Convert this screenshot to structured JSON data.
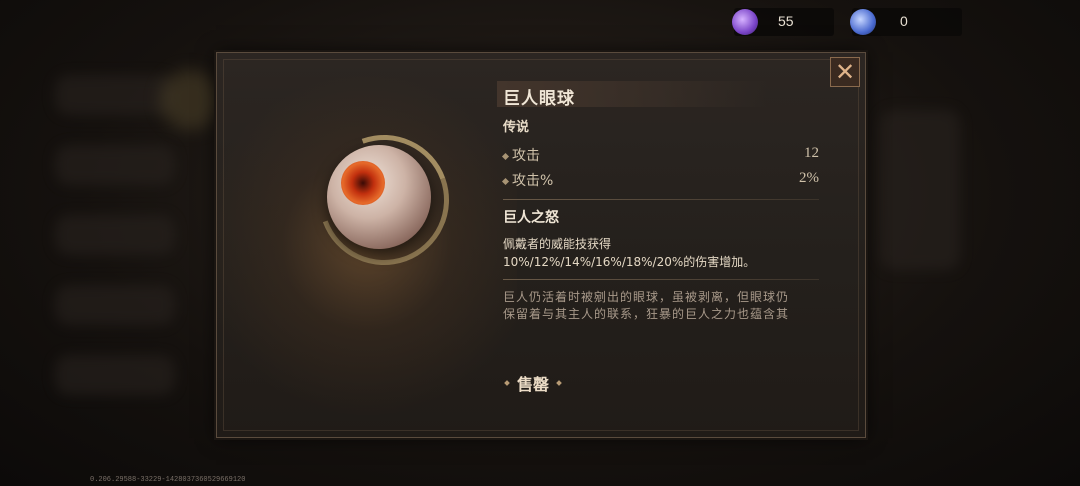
{
  "currency": [
    {
      "icon": "purple-gem-icon",
      "value": "55",
      "color": "#8a5bd6"
    },
    {
      "icon": "blue-orb-icon",
      "value": "0",
      "color": "#5a79d6"
    }
  ],
  "item": {
    "name": "巨人眼球",
    "rarity": "传说",
    "stats": [
      {
        "label": "攻击",
        "value": "12"
      },
      {
        "label": "攻击%",
        "value": "2%"
      }
    ],
    "skill": {
      "name": "巨人之怒",
      "desc_line1": "佩戴者的威能技获得",
      "desc_line2": "10%/12%/14%/16%/18%/20%的伤害增加。"
    },
    "lore_line1": "巨人仍活着时被剜出的眼球，虽被剥离，但眼球仍",
    "lore_line2": "保留着与其主人的联系，狂暴的巨人之力也蕴含其"
  },
  "actions": {
    "sell_label": "售罄",
    "close_icon": "close-x-icon"
  },
  "footer": {
    "build_id": "0.206.29588-33229-1428037360529669120"
  },
  "colors": {
    "panel_bg": "#26211d",
    "accent_gold": "#a89474",
    "close_accent": "#e0b48a"
  }
}
